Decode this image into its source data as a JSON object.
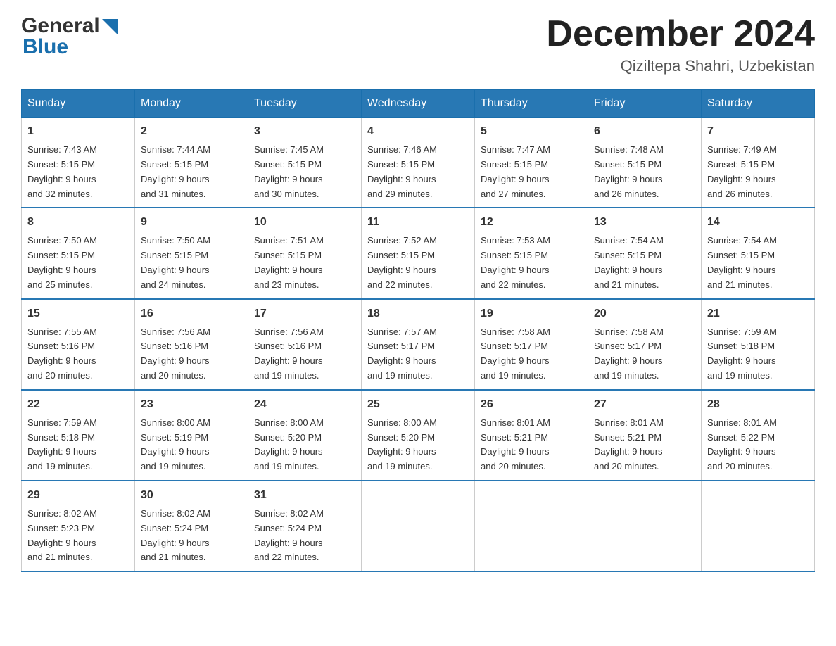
{
  "header": {
    "month_title": "December 2024",
    "location": "Qiziltepa Shahri, Uzbekistan"
  },
  "days_of_week": [
    "Sunday",
    "Monday",
    "Tuesday",
    "Wednesday",
    "Thursday",
    "Friday",
    "Saturday"
  ],
  "weeks": [
    [
      {
        "day": "1",
        "sunrise": "7:43 AM",
        "sunset": "5:15 PM",
        "daylight": "9 hours and 32 minutes."
      },
      {
        "day": "2",
        "sunrise": "7:44 AM",
        "sunset": "5:15 PM",
        "daylight": "9 hours and 31 minutes."
      },
      {
        "day": "3",
        "sunrise": "7:45 AM",
        "sunset": "5:15 PM",
        "daylight": "9 hours and 30 minutes."
      },
      {
        "day": "4",
        "sunrise": "7:46 AM",
        "sunset": "5:15 PM",
        "daylight": "9 hours and 29 minutes."
      },
      {
        "day": "5",
        "sunrise": "7:47 AM",
        "sunset": "5:15 PM",
        "daylight": "9 hours and 27 minutes."
      },
      {
        "day": "6",
        "sunrise": "7:48 AM",
        "sunset": "5:15 PM",
        "daylight": "9 hours and 26 minutes."
      },
      {
        "day": "7",
        "sunrise": "7:49 AM",
        "sunset": "5:15 PM",
        "daylight": "9 hours and 26 minutes."
      }
    ],
    [
      {
        "day": "8",
        "sunrise": "7:50 AM",
        "sunset": "5:15 PM",
        "daylight": "9 hours and 25 minutes."
      },
      {
        "day": "9",
        "sunrise": "7:50 AM",
        "sunset": "5:15 PM",
        "daylight": "9 hours and 24 minutes."
      },
      {
        "day": "10",
        "sunrise": "7:51 AM",
        "sunset": "5:15 PM",
        "daylight": "9 hours and 23 minutes."
      },
      {
        "day": "11",
        "sunrise": "7:52 AM",
        "sunset": "5:15 PM",
        "daylight": "9 hours and 22 minutes."
      },
      {
        "day": "12",
        "sunrise": "7:53 AM",
        "sunset": "5:15 PM",
        "daylight": "9 hours and 22 minutes."
      },
      {
        "day": "13",
        "sunrise": "7:54 AM",
        "sunset": "5:15 PM",
        "daylight": "9 hours and 21 minutes."
      },
      {
        "day": "14",
        "sunrise": "7:54 AM",
        "sunset": "5:15 PM",
        "daylight": "9 hours and 21 minutes."
      }
    ],
    [
      {
        "day": "15",
        "sunrise": "7:55 AM",
        "sunset": "5:16 PM",
        "daylight": "9 hours and 20 minutes."
      },
      {
        "day": "16",
        "sunrise": "7:56 AM",
        "sunset": "5:16 PM",
        "daylight": "9 hours and 20 minutes."
      },
      {
        "day": "17",
        "sunrise": "7:56 AM",
        "sunset": "5:16 PM",
        "daylight": "9 hours and 19 minutes."
      },
      {
        "day": "18",
        "sunrise": "7:57 AM",
        "sunset": "5:17 PM",
        "daylight": "9 hours and 19 minutes."
      },
      {
        "day": "19",
        "sunrise": "7:58 AM",
        "sunset": "5:17 PM",
        "daylight": "9 hours and 19 minutes."
      },
      {
        "day": "20",
        "sunrise": "7:58 AM",
        "sunset": "5:17 PM",
        "daylight": "9 hours and 19 minutes."
      },
      {
        "day": "21",
        "sunrise": "7:59 AM",
        "sunset": "5:18 PM",
        "daylight": "9 hours and 19 minutes."
      }
    ],
    [
      {
        "day": "22",
        "sunrise": "7:59 AM",
        "sunset": "5:18 PM",
        "daylight": "9 hours and 19 minutes."
      },
      {
        "day": "23",
        "sunrise": "8:00 AM",
        "sunset": "5:19 PM",
        "daylight": "9 hours and 19 minutes."
      },
      {
        "day": "24",
        "sunrise": "8:00 AM",
        "sunset": "5:20 PM",
        "daylight": "9 hours and 19 minutes."
      },
      {
        "day": "25",
        "sunrise": "8:00 AM",
        "sunset": "5:20 PM",
        "daylight": "9 hours and 19 minutes."
      },
      {
        "day": "26",
        "sunrise": "8:01 AM",
        "sunset": "5:21 PM",
        "daylight": "9 hours and 20 minutes."
      },
      {
        "day": "27",
        "sunrise": "8:01 AM",
        "sunset": "5:21 PM",
        "daylight": "9 hours and 20 minutes."
      },
      {
        "day": "28",
        "sunrise": "8:01 AM",
        "sunset": "5:22 PM",
        "daylight": "9 hours and 20 minutes."
      }
    ],
    [
      {
        "day": "29",
        "sunrise": "8:02 AM",
        "sunset": "5:23 PM",
        "daylight": "9 hours and 21 minutes."
      },
      {
        "day": "30",
        "sunrise": "8:02 AM",
        "sunset": "5:24 PM",
        "daylight": "9 hours and 21 minutes."
      },
      {
        "day": "31",
        "sunrise": "8:02 AM",
        "sunset": "5:24 PM",
        "daylight": "9 hours and 22 minutes."
      },
      null,
      null,
      null,
      null
    ]
  ],
  "labels": {
    "sunrise_prefix": "Sunrise: ",
    "sunset_prefix": "Sunset: ",
    "daylight_prefix": "Daylight: "
  }
}
